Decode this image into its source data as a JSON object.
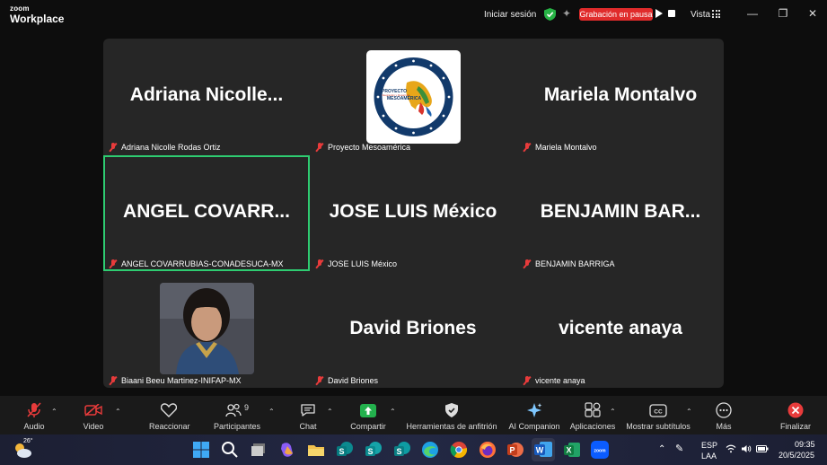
{
  "app": {
    "brand_top": "zoom",
    "brand_bottom": "Workplace"
  },
  "titlebar": {
    "signin_label": "Iniciar sesión",
    "recording_label": "Grabación en pausa",
    "view_label": "Vista"
  },
  "participants": [
    {
      "display": "Adriana  Nicolle...",
      "name": "Adriana Nicolle Rodas Ortiz",
      "muted": true
    },
    {
      "display": "",
      "name": "Proyecto Mesoamérica",
      "muted": true,
      "avatar": "logo"
    },
    {
      "display": "Mariela Montalvo",
      "name": "Mariela Montalvo",
      "muted": true
    },
    {
      "display": "ANGEL  COVARR...",
      "name": "ANGEL COVARRUBIAS-CONADESUCA-MX",
      "muted": true,
      "active_speaker": true
    },
    {
      "display": "JOSE LUIS México",
      "name": "JOSE LUIS México",
      "muted": true
    },
    {
      "display": "BENJAMIN  BAR...",
      "name": "BENJAMIN BARRIGA",
      "muted": true
    },
    {
      "display": "",
      "name": "Biaani Beeu Martinez-INIFAP-MX",
      "muted": true,
      "avatar": "photo"
    },
    {
      "display": "David Briones",
      "name": "David Briones",
      "muted": true
    },
    {
      "display": "vicente anaya",
      "name": "vicente anaya",
      "muted": true
    }
  ],
  "logo_text": {
    "line1": "PROYECTO",
    "line2": "Integración y Desarrollo",
    "line3": "MESOAMÉRICA"
  },
  "toolbar": {
    "audio": "Audio",
    "video": "Video",
    "react": "Reaccionar",
    "participants": "Participantes",
    "participants_count": "9",
    "chat": "Chat",
    "share": "Compartir",
    "host_tools": "Herramientas de anfitrión",
    "ai_companion": "AI Companion",
    "apps": "Aplicaciones",
    "captions": "Mostrar subtítulos",
    "more": "Más",
    "end": "Finalizar"
  },
  "taskbar": {
    "weather_temp": "26°",
    "lang_top": "ESP",
    "lang_bottom": "LAA",
    "time": "09:35",
    "date": "20/5/2025"
  },
  "colors": {
    "accent_green": "#2ecc71",
    "rec_red": "#e02b2b",
    "end_red": "#e83b3b"
  }
}
